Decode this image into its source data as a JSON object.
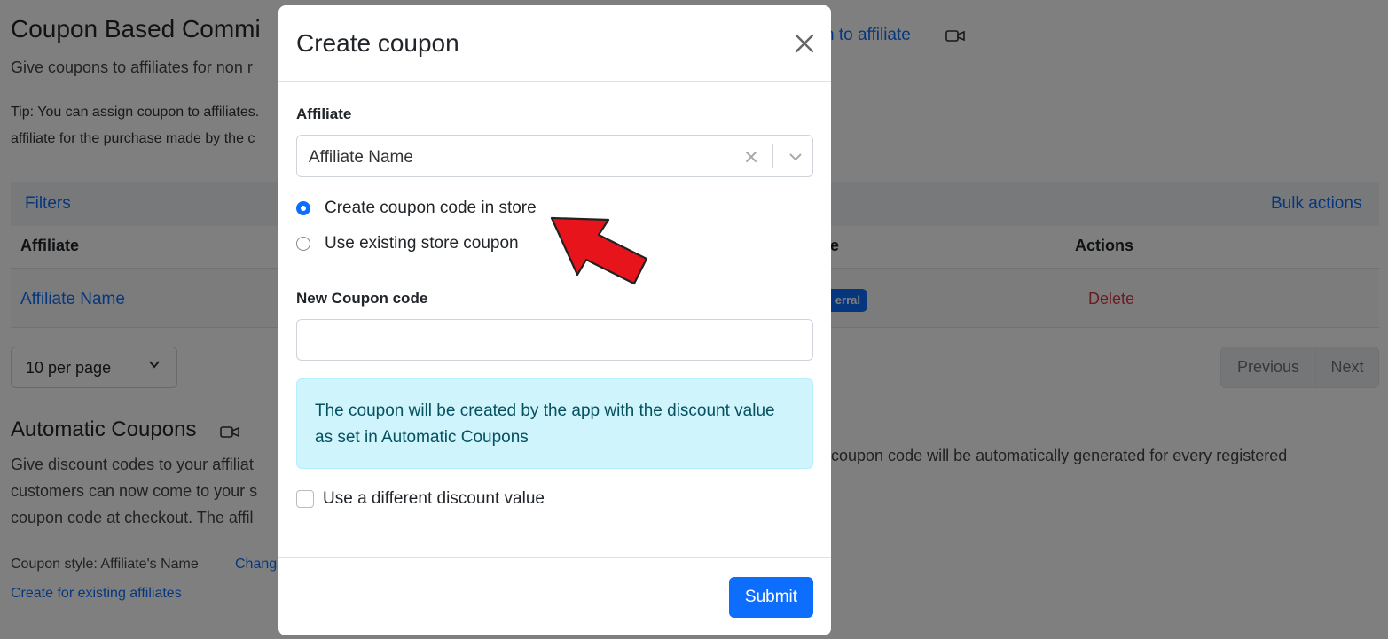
{
  "background": {
    "title": "Coupon Based Commi",
    "title_link": "n to affiliate",
    "subtitle": "Give coupons to affiliates for non r",
    "tip_line1": "Tip: You can assign coupon to affiliates.",
    "tip_line2": "affiliate for the purchase made by the c",
    "filters_label": "Filters",
    "bulk_actions_label": "Bulk actions",
    "table": {
      "col_affiliate": "Affiliate",
      "col_type_partial": "e",
      "col_actions": "Actions",
      "row": {
        "affiliate": "Affiliate Name",
        "badge": "erral",
        "action": "Delete"
      }
    },
    "per_page": "10 per page",
    "pagination": {
      "previous": "Previous",
      "next": "Next"
    },
    "auto_coupons": {
      "heading": "Automatic Coupons",
      "para_line1": "Give discount codes to your affiliat",
      "para_line2": "customers can now come to your s",
      "para_line3": "coupon code at checkout. The affil",
      "para_right": "coupon code will be automatically generated for every registered",
      "style_label": "Coupon style: Affiliate's Name",
      "change_link": "Chang",
      "create_existing_link": "Create for existing affiliates"
    }
  },
  "modal": {
    "title": "Create coupon",
    "affiliate_label": "Affiliate",
    "affiliate_value": "Affiliate Name",
    "radio_options": [
      {
        "label": "Create coupon code in store",
        "checked": true
      },
      {
        "label": "Use existing store coupon",
        "checked": false
      }
    ],
    "coupon_code_label": "New Coupon code",
    "coupon_code_value": "",
    "alert_text": "The coupon will be created by the app with the discount value as set in Automatic Coupons",
    "checkbox_label": "Use a different discount value",
    "checkbox_checked": false,
    "submit_label": "Submit"
  },
  "colors": {
    "primary": "#0d6efd",
    "danger": "#dc3545",
    "info_bg": "#cff4fc",
    "info_text": "#055160",
    "arrow": "#e8141c"
  },
  "icons": {
    "close": "close-icon",
    "clear": "clear-x-icon",
    "dropdown": "chevron-down-icon",
    "video": "video-camera-icon",
    "annotation_arrow": "red-arrow-icon"
  }
}
